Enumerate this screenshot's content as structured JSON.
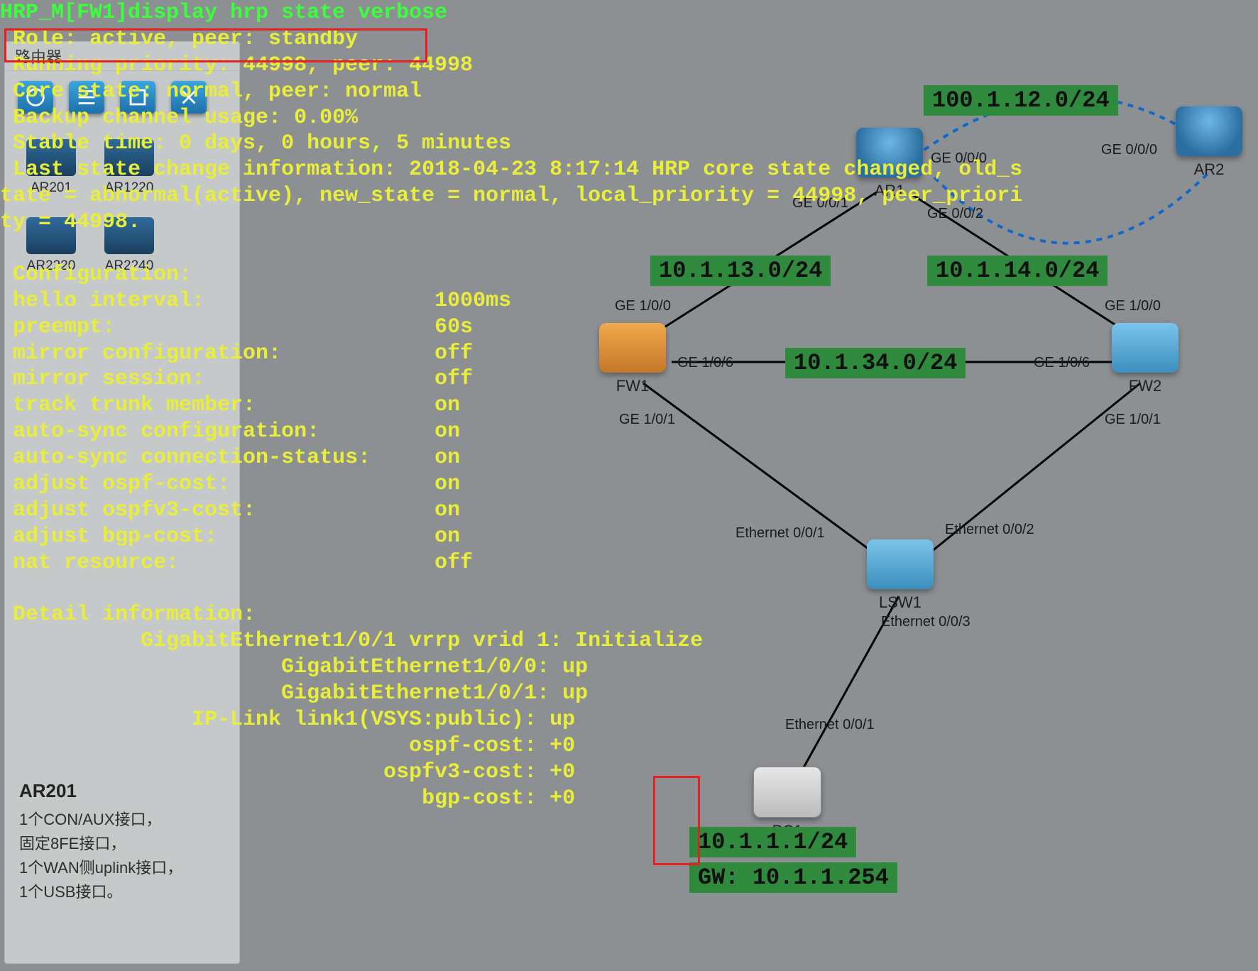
{
  "sidebar": {
    "title": "路由器",
    "devices": [
      {
        "label": "AR201"
      },
      {
        "label": "AR1220"
      },
      {
        "label": "AR2220"
      },
      {
        "label": "AR2240"
      }
    ],
    "info": {
      "title": "AR201",
      "lines": [
        "1个CON/AUX接口，",
        "固定8FE接口，",
        "1个WAN侧uplink接口，",
        "1个USB接口。"
      ]
    }
  },
  "nodes": {
    "ar1": {
      "label": "AR1"
    },
    "ar2": {
      "label": "AR2"
    },
    "fw1": {
      "label": "FW1"
    },
    "fw2": {
      "label": "FW2"
    },
    "lsw1": {
      "label": "LSW1"
    },
    "pc1": {
      "label": "PC1"
    }
  },
  "ports": {
    "ar1_g000": "GE 0/0/0",
    "ar1_g001": "GE 0/0/1",
    "ar1_g002": "GE 0/0/2",
    "ar2_g000": "GE 0/0/0",
    "fw1_g100": "GE 1/0/0",
    "fw1_g106": "GE 1/0/6",
    "fw1_g101": "GE 1/0/1",
    "fw2_g100": "GE 1/0/0",
    "fw2_g106": "GE 1/0/6",
    "fw2_g101": "GE 1/0/1",
    "lsw_e01": "Ethernet 0/0/1",
    "lsw_e02": "Ethernet 0/0/2",
    "lsw_e03": "Ethernet 0/0/3",
    "pc_e01": "Ethernet 0/0/1"
  },
  "subnets": {
    "s12": "100.1.12.0/24",
    "s13": "10.1.13.0/24",
    "s14": "10.1.14.0/24",
    "s34": "10.1.34.0/24",
    "pcip": "10.1.1.1/24",
    "pcgw": "GW: 10.1.1.254"
  },
  "cli": {
    "cmd": "HRP_M[FW1]display hrp state verbose",
    "l1": " Role: active, peer: standby",
    "l2": " Running priority: 44998, peer: 44998",
    "l3": " Core state: normal, peer: normal",
    "l4": " Backup channel usage: 0.00%",
    "l5": " Stable time: 0 days, 0 hours, 5 minutes",
    "l6": " Last state change information: 2018-04-23 8:17:14 HRP core state changed, old_s",
    "l7": "tate = abnormal(active), new_state = normal, local_priority = 44998, peer_priori",
    "l8": "ty = 44998.",
    "cfgh": " Configuration:",
    "cfg": [
      [
        " hello interval:",
        "1000ms"
      ],
      [
        " preempt:",
        "60s"
      ],
      [
        " mirror configuration:",
        "off"
      ],
      [
        " mirror session:",
        "off"
      ],
      [
        " track trunk member:",
        "on"
      ],
      [
        " auto-sync configuration:",
        "on"
      ],
      [
        " auto-sync connection-status:",
        "on"
      ],
      [
        " adjust ospf-cost:",
        "on"
      ],
      [
        " adjust ospfv3-cost:",
        "on"
      ],
      [
        " adjust bgp-cost:",
        "on"
      ],
      [
        " nat resource:",
        "off"
      ]
    ],
    "deth": " Detail information:",
    "det": [
      [
        "           GigabitEthernet1/0/1 vrrp vrid 1:",
        "Initialize"
      ],
      [
        "                      GigabitEthernet1/0/0:",
        "up"
      ],
      [
        "                      GigabitEthernet1/0/1:",
        "up"
      ],
      [
        "               IP-Link link1(VSYS:public):",
        "up"
      ],
      [
        "                                ospf-cost:",
        "+0"
      ],
      [
        "                              ospfv3-cost:",
        "+0"
      ],
      [
        "                                 bgp-cost:",
        "+0"
      ]
    ]
  }
}
